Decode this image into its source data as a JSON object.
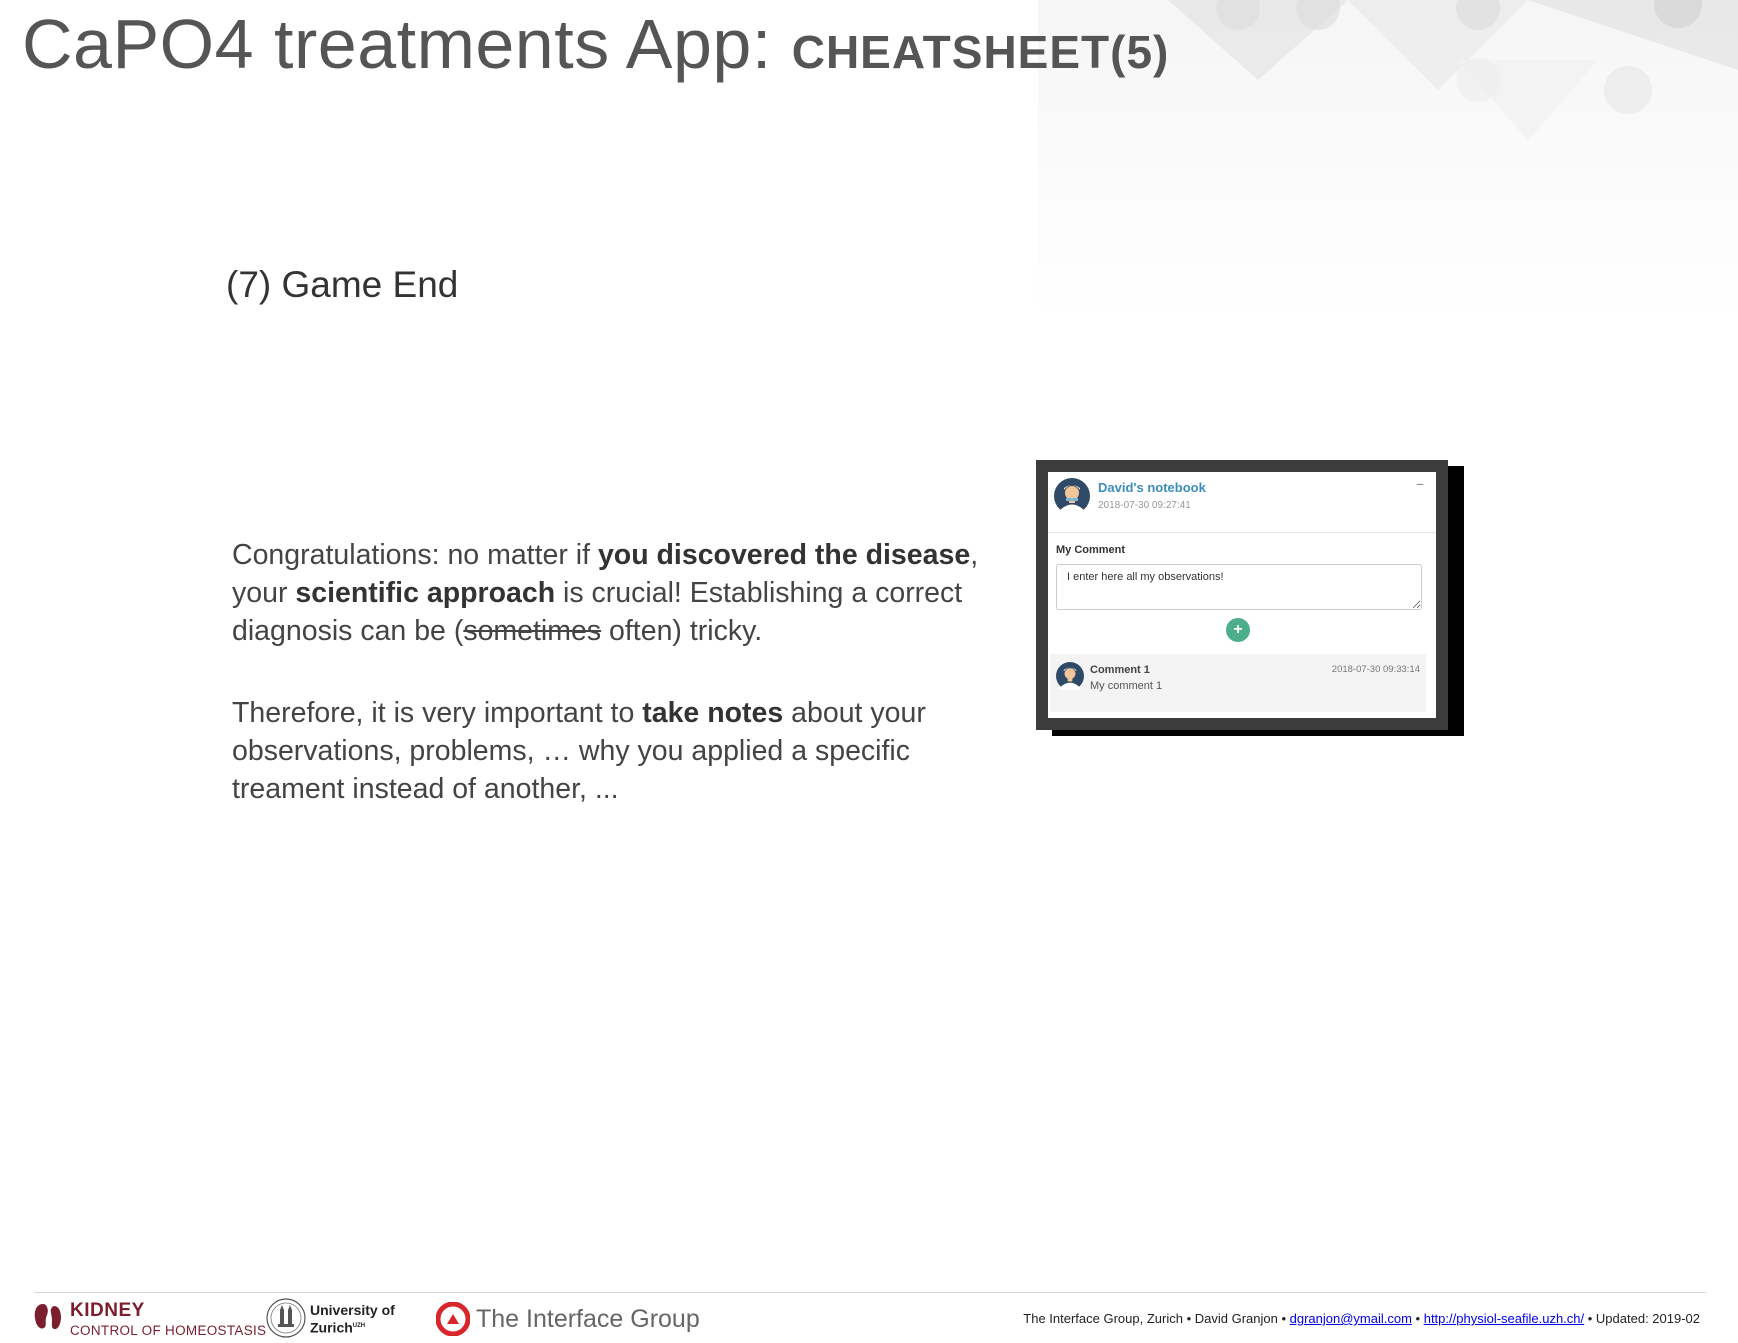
{
  "title": {
    "main": "CaPO4 treatments App: ",
    "sub": "CHEATSHEET(5)"
  },
  "section": {
    "heading": "(7) Game End"
  },
  "body": {
    "p1": {
      "t1": "Congratulations: no matter if ",
      "b1": "you discovered the disease",
      "t2": ", your ",
      "b2": "scientific approach",
      "t3": " is crucial! Establishing a correct diagnosis can be (",
      "strike": "sometimes",
      "t4": " often) tricky."
    },
    "p2": {
      "t1": "Therefore, it is very important to ",
      "b1": "take notes",
      "t2": " about your observations, problems, … why you applied a specific treament instead of another, ..."
    }
  },
  "notebook": {
    "title": "David's notebook",
    "date": "2018-07-30 09:27:41",
    "collapse_label": "−",
    "comment_label": "My Comment",
    "comment_value": "I enter here all my observations!",
    "add_label": "+",
    "comments": [
      {
        "title": "Comment 1",
        "text": "My comment 1",
        "date": "2018-07-30 09:33:14"
      }
    ]
  },
  "footer": {
    "kidney": {
      "line1": "KIDNEY",
      "line2": "CONTROL OF HOMEOSTASIS"
    },
    "uzh": {
      "line1": "University of",
      "line2": "Zurich",
      "sup": "UZH"
    },
    "tig": {
      "name": "The Interface Group"
    },
    "info": {
      "org": "The Interface Group, Zurich • David Granjon • ",
      "email": "dgranjon@ymail.com",
      "sep": " • ",
      "url": "http://physiol-seafile.uzh.ch/",
      "updated": " •  Updated: 2019-02"
    }
  },
  "colors": {
    "accent_blue": "#3c8dbc",
    "add_green": "#4cae8a",
    "kidney_red": "#7b1f2e",
    "tig_red": "#d7262c"
  }
}
